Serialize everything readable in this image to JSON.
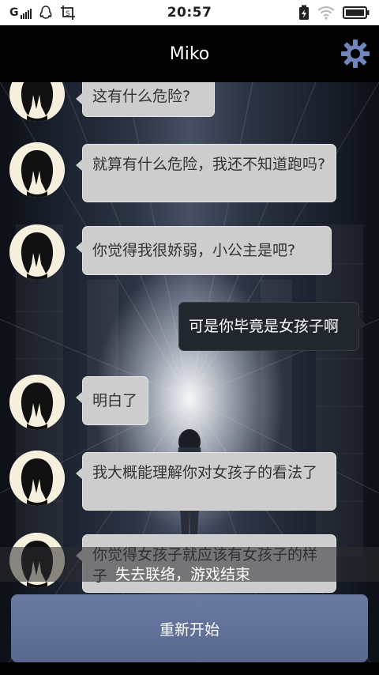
{
  "status_bar": {
    "carrier": "G",
    "time": "20:57"
  },
  "header": {
    "title": "Miko",
    "settings_icon": "gear-icon"
  },
  "messages": [
    {
      "from": "miko",
      "text": "这有什么危险?"
    },
    {
      "from": "miko",
      "text": "就算有什么危险，我还不知道跑吗?"
    },
    {
      "from": "miko",
      "text": "你觉得我很娇弱，小公主是吧?"
    },
    {
      "from": "player",
      "text": "可是你毕竟是女孩子啊"
    },
    {
      "from": "miko",
      "text": "明白了"
    },
    {
      "from": "miko",
      "text": "我大概能理解你对女孩子的看法了"
    },
    {
      "from": "miko",
      "text": "你觉得女孩子就应该有女孩子的样子"
    }
  ],
  "game_status": "失去联络，游戏结束",
  "restart_label": "重新开始",
  "colors": {
    "header_bg": "#000000",
    "gear": "#6f86bd",
    "incoming_bubble": "#cdcdcd",
    "outgoing_bubble": "#22262d",
    "restart_button": "#5f6f97"
  }
}
